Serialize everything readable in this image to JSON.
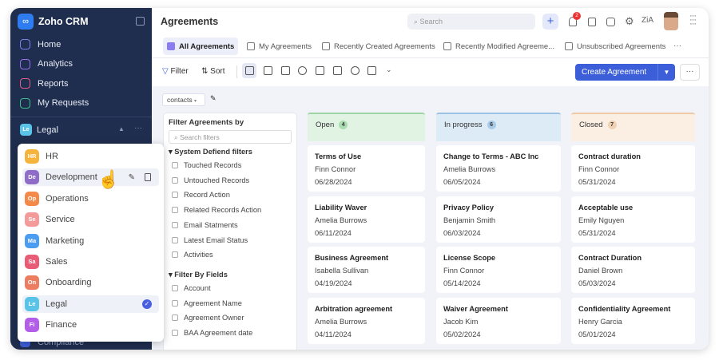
{
  "app": {
    "name": "Zoho CRM",
    "logo_icon": "zoho-rings-icon"
  },
  "sidebar": {
    "items": [
      {
        "label": "Home",
        "icon": "home-icon",
        "color": "#7b7ff0"
      },
      {
        "label": "Analytics",
        "icon": "analytics-icon",
        "color": "#9b6cf0"
      },
      {
        "label": "Reports",
        "icon": "reports-icon",
        "color": "#e25c8a"
      },
      {
        "label": "My Requests",
        "icon": "requests-icon",
        "color": "#3bbf8a"
      }
    ],
    "team": {
      "badge": "Le",
      "label": "Legal",
      "color": "#5ac4e8"
    },
    "below": "Compliance",
    "teams": [
      {
        "badge": "HR",
        "label": "HR",
        "color": "#f6b43c"
      },
      {
        "badge": "De",
        "label": "Development",
        "color": "#8e6cc8"
      },
      {
        "badge": "Op",
        "label": "Operations",
        "color": "#f48a4a"
      },
      {
        "badge": "Se",
        "label": "Service",
        "color": "#f59a9a"
      },
      {
        "badge": "Ma",
        "label": "Marketing",
        "color": "#4a9df0"
      },
      {
        "badge": "Sa",
        "label": "Sales",
        "color": "#e85c76"
      },
      {
        "badge": "On",
        "label": "Onboarding",
        "color": "#ec7d60"
      },
      {
        "badge": "Le",
        "label": "Legal",
        "color": "#5ac4e8"
      },
      {
        "badge": "Fi",
        "label": "Finance",
        "color": "#b35de8"
      }
    ]
  },
  "header": {
    "title": "Agreements",
    "search_placeholder": "Search",
    "notifications": "2"
  },
  "tabs": [
    "All Agreements",
    "My Agreements",
    "Recently Created Agreements",
    "Recently Modified Agreeme...",
    "Unsubscribed Agreements"
  ],
  "toolbar": {
    "filter": "Filter",
    "sort": "Sort",
    "create": "Create Agreement",
    "accent": "#3c5ed8"
  },
  "filter": {
    "selector": "contacts",
    "title": "Filter Agreements by",
    "search_placeholder": "Search filters",
    "system_title": "System Defiend filters",
    "system": [
      "Touched Records",
      "Untouched Records",
      "Record Action",
      "Related Records Action",
      "Email Statments",
      "Latest Email Status",
      "Activities"
    ],
    "fields_title": "Filter By Fields",
    "fields": [
      "Account",
      "Agreement Name",
      "Agreement Owner",
      "BAA Agreement date"
    ]
  },
  "columns": [
    {
      "title": "Open",
      "count": "4",
      "bg": "#e1f3e3",
      "line": "#9fd4a6",
      "cbg": "#a9dcb0",
      "cards": [
        [
          "Terms of Use",
          "Finn Connor",
          "06/28/2024"
        ],
        [
          "Liability Waver",
          "Amelia Burrows",
          "06/11/2024"
        ],
        [
          "Business Agreement",
          "Isabella Sullivan",
          "04/19/2024"
        ],
        [
          "Arbitration agreement",
          "Amelia Burrows",
          "04/11/2024"
        ]
      ]
    },
    {
      "title": "In progress",
      "count": "6",
      "bg": "#dcebf6",
      "line": "#9cc3e4",
      "cbg": "#a9cbe8",
      "cards": [
        [
          "Change to Terms - ABC Inc",
          "Amelia Burrows",
          "06/05/2024"
        ],
        [
          "Privacy Policy",
          "Benjamin Smith",
          "06/03/2024"
        ],
        [
          "License Scope",
          "Finn Connor",
          "05/14/2024"
        ],
        [
          "Waiver Agreement",
          "Jacob Kim",
          "05/02/2024"
        ]
      ]
    },
    {
      "title": "Closed",
      "count": "7",
      "bg": "#fbeee2",
      "line": "#efc9a6",
      "cbg": "#efd1b4",
      "cards": [
        [
          "Contract duration",
          "Finn Connor",
          "05/31/2024"
        ],
        [
          "Acceptable use",
          "Emily Nguyen",
          "05/31/2024"
        ],
        [
          "Contract Duration",
          "Daniel Brown",
          "05/03/2024"
        ],
        [
          "Confidentiality Agreement",
          "Henry Garcia",
          "05/01/2024"
        ]
      ]
    }
  ]
}
